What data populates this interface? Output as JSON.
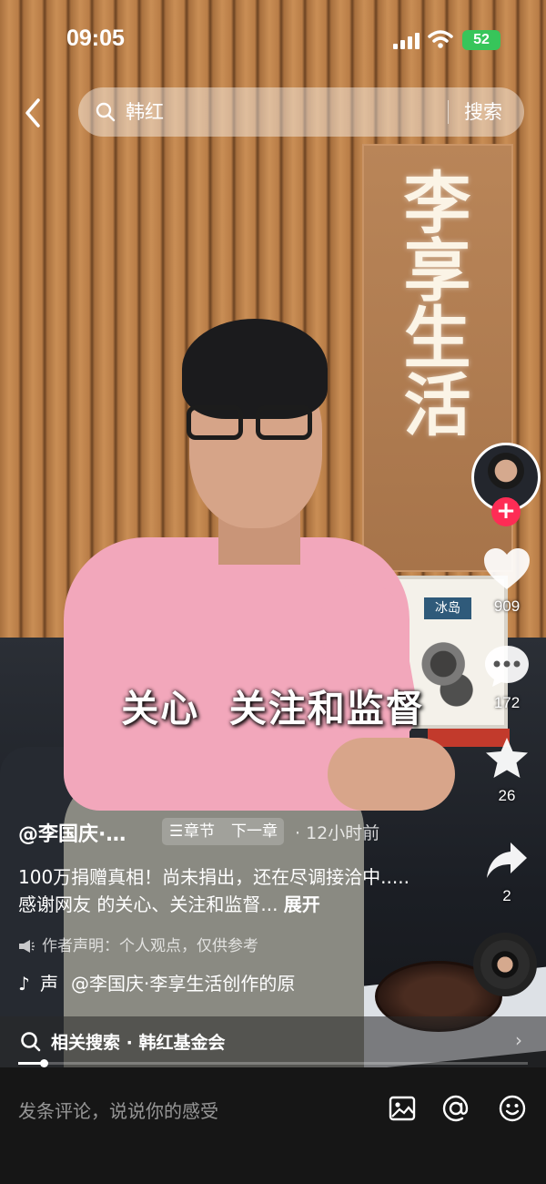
{
  "status_bar": {
    "time": "09:05",
    "battery": "52"
  },
  "search": {
    "query": "韩红",
    "button_label": "搜索"
  },
  "background_sign": {
    "text": "李享生活"
  },
  "product_box": {
    "label": "冰岛"
  },
  "caption": "关心  关注和监督",
  "rail": {
    "likes": "909",
    "comments": "172",
    "favorites": "26",
    "shares": "2"
  },
  "post": {
    "author": "@李国庆·…",
    "chapter_label": "章节",
    "next_chapter_label": "下一章",
    "time_ago": "· 12小时前",
    "description": "100万捐赠真相！尚未捐出，还在尽调接洽中.....感谢网友 的关心、关注和监督... ",
    "expand_label": "展开",
    "disclaimer": "作者声明：个人观点，仅供参考",
    "sound_label": "声",
    "sound_credit": "@李国庆·李享生活创作的原"
  },
  "related": {
    "text": "相关搜索 · 韩红基金会"
  },
  "playback": {
    "progress": 0.05
  },
  "comment": {
    "placeholder": "发条评论，说说你的感受"
  },
  "colors": {
    "follow": "#fe2c55",
    "battery": "#37c55a",
    "shirt": "#f2a7bb"
  }
}
